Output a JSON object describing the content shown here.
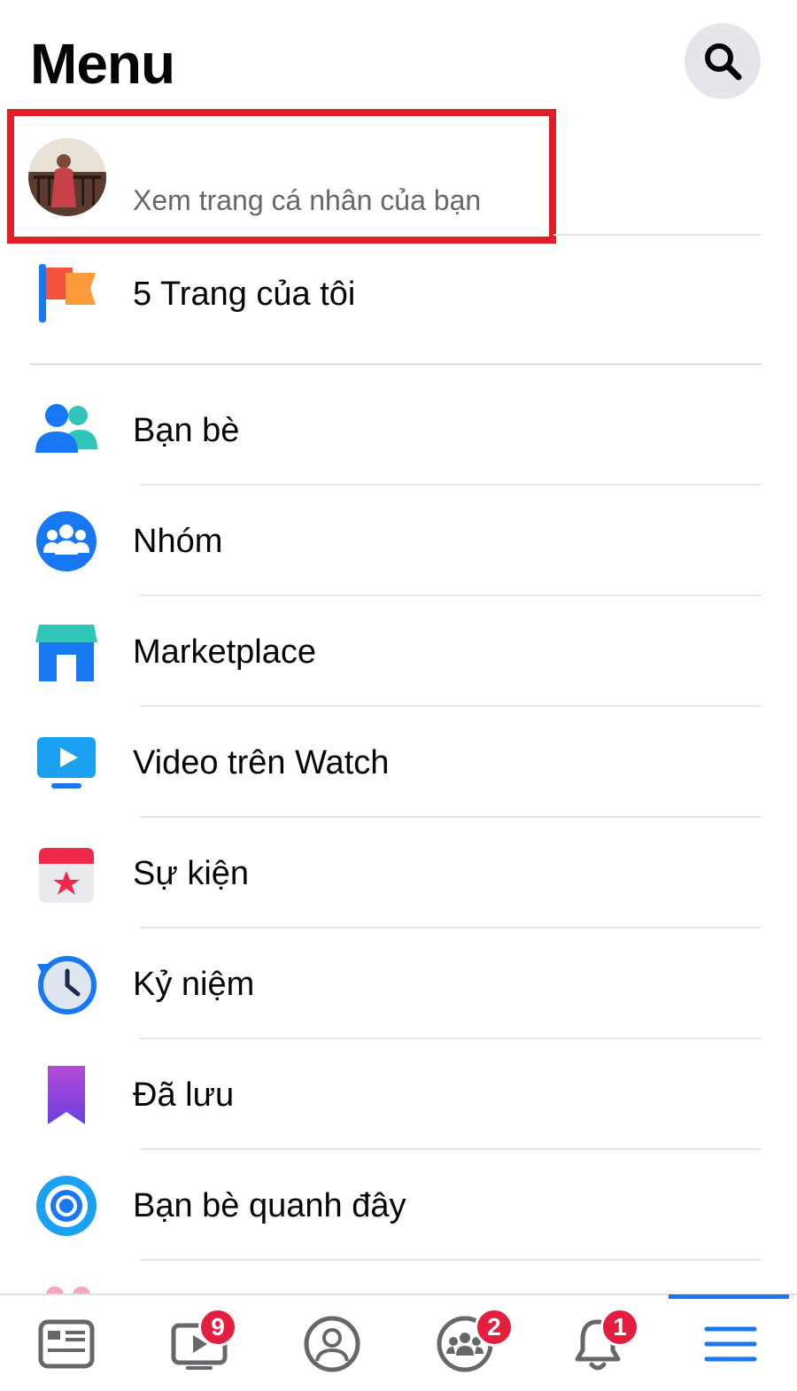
{
  "header": {
    "title": "Menu"
  },
  "profile": {
    "subtitle": "Xem trang cá nhân của bạn"
  },
  "pages": {
    "label": "5 Trang của tôi"
  },
  "menu_items": [
    {
      "label": "Bạn bè",
      "icon": "friends-icon"
    },
    {
      "label": "Nhóm",
      "icon": "groups-icon"
    },
    {
      "label": "Marketplace",
      "icon": "marketplace-icon"
    },
    {
      "label": "Video trên Watch",
      "icon": "watch-video-icon"
    },
    {
      "label": "Sự kiện",
      "icon": "events-calendar-icon"
    },
    {
      "label": "Kỷ niệm",
      "icon": "memories-clock-icon"
    },
    {
      "label": "Đã lưu",
      "icon": "saved-bookmark-icon"
    },
    {
      "label": "Bạn bè quanh đây",
      "icon": "nearby-friends-icon"
    }
  ],
  "tabbar": {
    "tabs": [
      {
        "name": "news-feed",
        "icon": "news-feed-icon",
        "badge": ""
      },
      {
        "name": "watch",
        "icon": "watch-icon",
        "badge": "9"
      },
      {
        "name": "profile",
        "icon": "profile-icon",
        "badge": ""
      },
      {
        "name": "groups",
        "icon": "groups-tab-icon",
        "badge": "2"
      },
      {
        "name": "notifications",
        "icon": "bell-icon",
        "badge": "1"
      },
      {
        "name": "menu",
        "icon": "hamburger-menu-icon",
        "badge": "",
        "active": true
      }
    ]
  },
  "colors": {
    "accent": "#1877f2",
    "highlight": "#e01e25",
    "badge": "#e41e3f",
    "secondary_text": "#65676b"
  }
}
